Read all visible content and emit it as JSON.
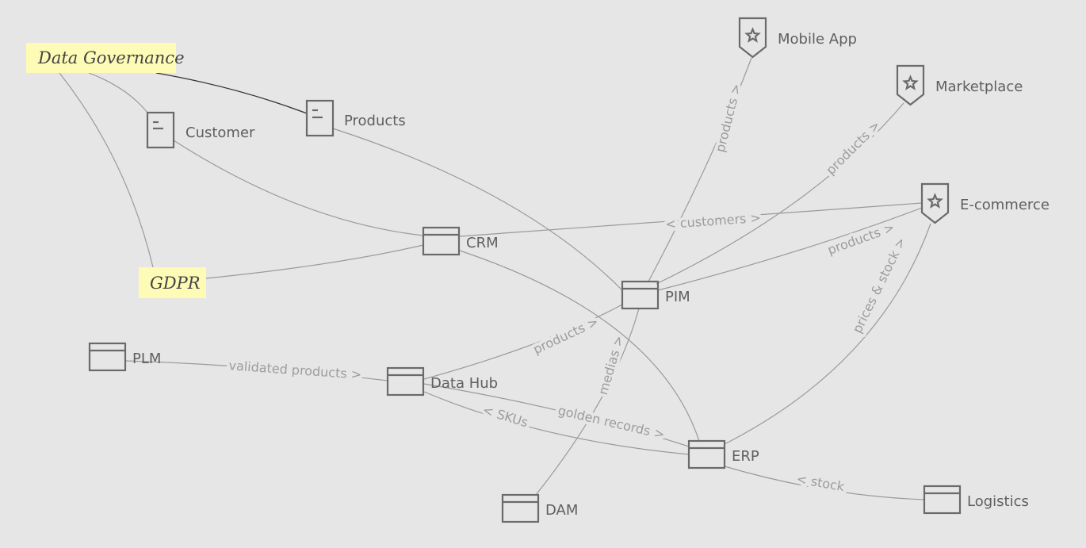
{
  "colors": {
    "background": "#e6e6e6",
    "sticky": "#fdfbb5",
    "edge": "#9a9a9a",
    "node": "#6a6a6a"
  },
  "stickies": {
    "governance": "Data Governance",
    "gdpr": "GDPR"
  },
  "nodes": {
    "customer": {
      "label": "Customer",
      "icon": "document-icon"
    },
    "products": {
      "label": "Products",
      "icon": "document-icon"
    },
    "crm": {
      "label": "CRM",
      "icon": "system-icon"
    },
    "pim": {
      "label": "PIM",
      "icon": "system-icon"
    },
    "plm": {
      "label": "PLM",
      "icon": "system-icon"
    },
    "datahub": {
      "label": "Data Hub",
      "icon": "system-icon"
    },
    "erp": {
      "label": "ERP",
      "icon": "system-icon"
    },
    "dam": {
      "label": "DAM",
      "icon": "system-icon"
    },
    "logistics": {
      "label": "Logistics",
      "icon": "system-icon"
    },
    "mobile": {
      "label": "Mobile App",
      "icon": "star-shield-icon"
    },
    "marketplace": {
      "label": "Marketplace",
      "icon": "star-shield-icon"
    },
    "ecommerce": {
      "label": "E-commerce",
      "icon": "star-shield-icon"
    }
  },
  "edges": {
    "crm_ecom": "< customers >",
    "pim_mobile": "products >",
    "pim_market": "products >",
    "pim_ecom": "products >",
    "dam_pim": "medias >",
    "hub_pim": "products >",
    "plm_hub": "validated products >",
    "hub_erp_skus": "< SKUs",
    "hub_erp_golden": "golden records >",
    "erp_ecom": "prices & stock >",
    "erp_log": "< stock"
  }
}
